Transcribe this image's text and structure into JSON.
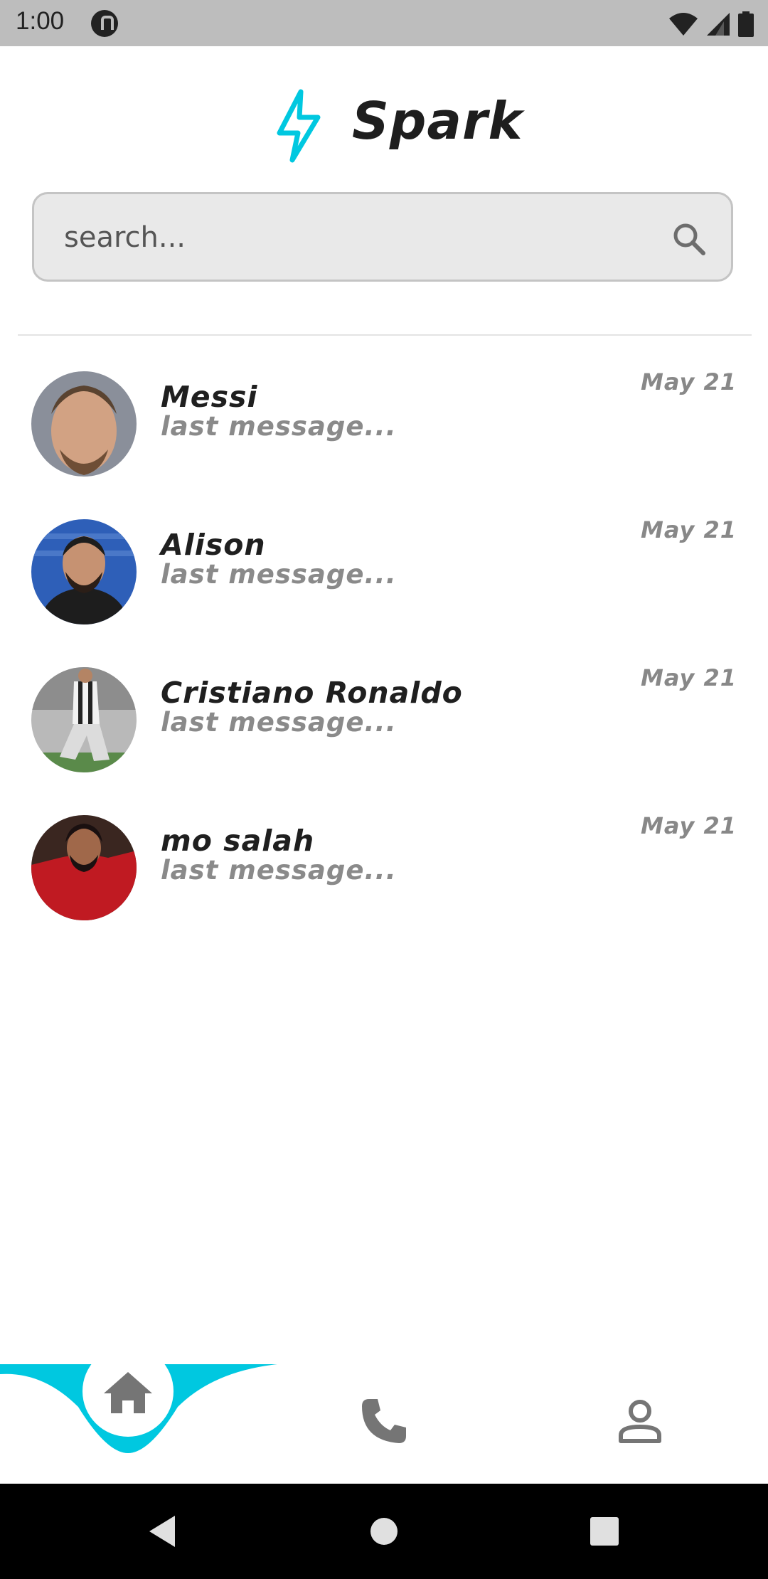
{
  "status_bar": {
    "time": "1:00",
    "icons": [
      "app-notification-icon",
      "wifi-icon",
      "signal-icon",
      "battery-icon"
    ]
  },
  "header": {
    "title": "Spark",
    "logo_icon": "lightning-bolt-icon",
    "accent_color": "#00c8e0"
  },
  "search": {
    "placeholder": "search...",
    "value": ""
  },
  "chats": [
    {
      "name": "Messi",
      "preview": "last message...",
      "date": "May 21",
      "avatar_colors": [
        "#c79a7c",
        "#5a4330"
      ]
    },
    {
      "name": "Alison",
      "preview": "last message...",
      "date": "May 21",
      "avatar_colors": [
        "#2e5fb8",
        "#1d1d1d"
      ]
    },
    {
      "name": "Cristiano Ronaldo",
      "preview": "last message...",
      "date": "May 21",
      "avatar_colors": [
        "#d8d8d8",
        "#555555"
      ]
    },
    {
      "name": "mo salah",
      "preview": "last message...",
      "date": "May 21",
      "avatar_colors": [
        "#c01a22",
        "#3a1b14"
      ]
    }
  ],
  "bottom_nav": {
    "items": [
      {
        "icon": "home-icon",
        "active": true
      },
      {
        "icon": "phone-icon",
        "active": false
      },
      {
        "icon": "person-icon",
        "active": false
      }
    ],
    "active_color": "#00c8e0",
    "icon_color": "#757575"
  },
  "system_nav": [
    "back-icon",
    "home-circle-icon",
    "recents-icon"
  ]
}
